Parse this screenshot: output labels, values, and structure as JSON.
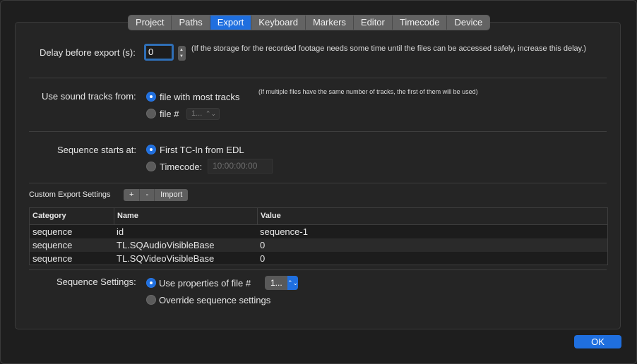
{
  "tabs": [
    "Project",
    "Paths",
    "Export",
    "Keyboard",
    "Markers",
    "Editor",
    "Timecode",
    "Device"
  ],
  "active_tab": "Export",
  "delay": {
    "label": "Delay before export (s):",
    "value": "0",
    "note": "(If the storage for the recorded footage needs some time until the files can be accessed safely, increase this delay.)"
  },
  "sound_tracks": {
    "label": "Use sound tracks from:",
    "option_most": "file with most tracks",
    "option_file": "file #",
    "file_number": "1...",
    "note": "(If multiple files have the same number of tracks, the first of them will be used)"
  },
  "sequence_start": {
    "label": "Sequence starts at:",
    "option_first": "First TC-In from EDL",
    "option_timecode": "Timecode:",
    "timecode_value": "10:00:00:00"
  },
  "custom_export": {
    "label": "Custom Export Settings",
    "add": "+",
    "remove": "-",
    "import": "Import"
  },
  "table": {
    "headers": [
      "Category",
      "Name",
      "Value"
    ],
    "rows": [
      [
        "sequence",
        "id",
        "sequence-1"
      ],
      [
        "sequence",
        "TL.SQAudioVisibleBase",
        "0"
      ],
      [
        "sequence",
        "TL.SQVideoVisibleBase",
        "0"
      ]
    ]
  },
  "sequence_settings": {
    "label": "Sequence Settings:",
    "option_use": "Use properties of file #",
    "file_number": "1...",
    "option_override": "Override sequence settings"
  },
  "ok_label": "OK",
  "colors": {
    "accent": "#1f6fdf",
    "background": "#1e1e1e",
    "panel": "#252525"
  }
}
